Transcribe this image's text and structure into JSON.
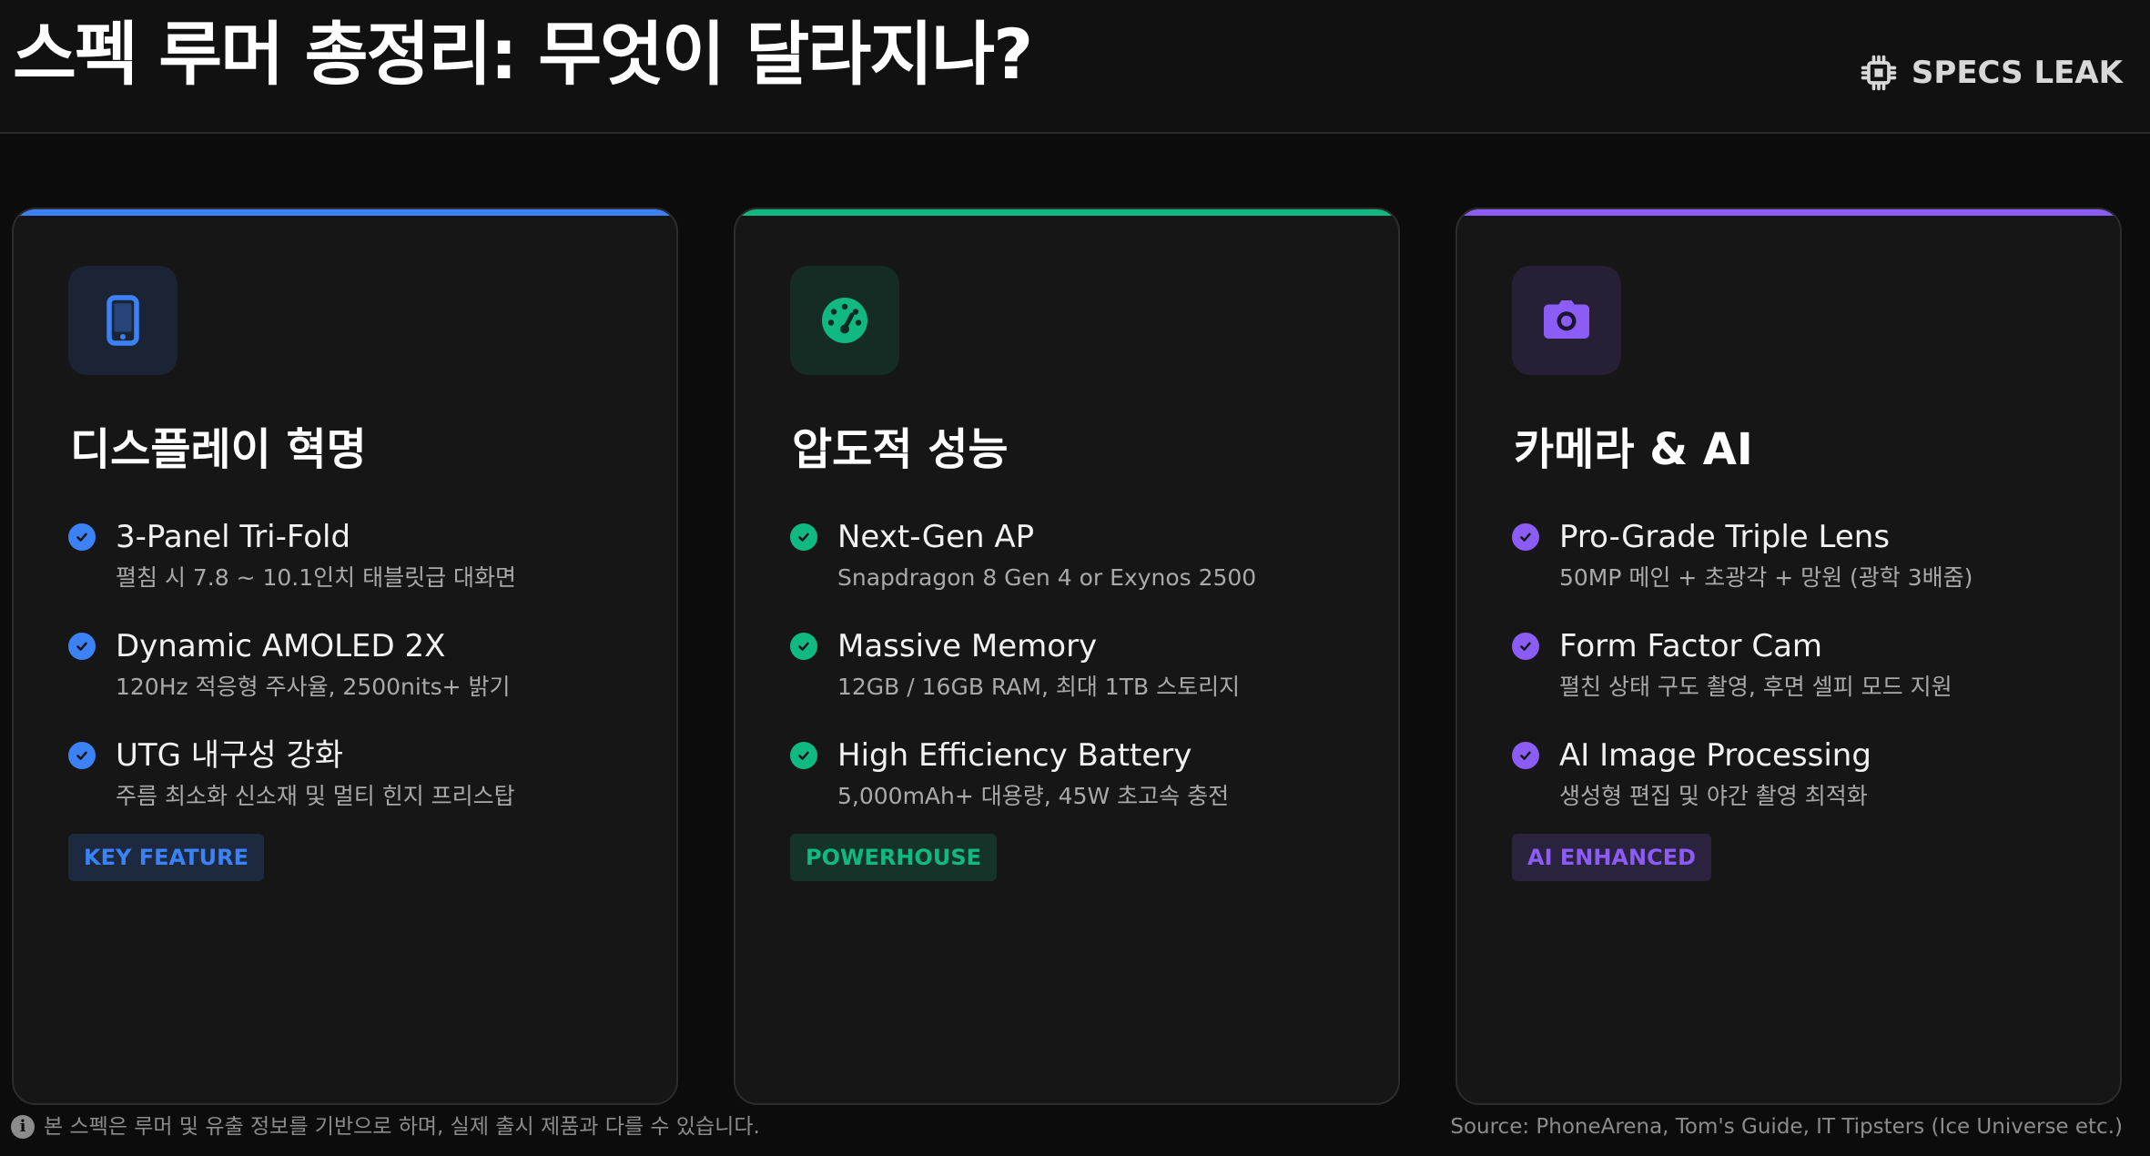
{
  "header": {
    "title": "스펙 루머 총정리: 무엇이 달라지나?",
    "brand": {
      "icon": "cpu-chip-icon",
      "label": "SPECS LEAK"
    }
  },
  "cards": [
    {
      "accent": "#3b82f6",
      "icon": "smartphone-icon",
      "title": "디스플레이 혁명",
      "features": [
        {
          "title": "3-Panel Tri-Fold",
          "desc": "펼침 시 7.8 ~ 10.1인치 태블릿급 대화면"
        },
        {
          "title": "Dynamic AMOLED 2X",
          "desc": "120Hz 적응형 주사율, 2500nits+ 밝기"
        },
        {
          "title": "UTG 내구성 강화",
          "desc": "주름 최소화 신소재 및 멀티 힌지 프리스탑"
        }
      ],
      "badge": "KEY FEATURE"
    },
    {
      "accent": "#10b981",
      "icon": "speedometer-icon",
      "title": "압도적 성능",
      "features": [
        {
          "title": "Next-Gen AP",
          "desc": "Snapdragon 8 Gen 4 or Exynos 2500"
        },
        {
          "title": "Massive Memory",
          "desc": "12GB / 16GB RAM, 최대 1TB 스토리지"
        },
        {
          "title": "High Efficiency Battery",
          "desc": "5,000mAh+ 대용량, 45W 초고속 충전"
        }
      ],
      "badge": "POWERHOUSE"
    },
    {
      "accent": "#8b5cf6",
      "icon": "camera-icon",
      "title": "카메라 & AI",
      "features": [
        {
          "title": "Pro-Grade Triple Lens",
          "desc": "50MP 메인 + 초광각 + 망원 (광학 3배줌)"
        },
        {
          "title": "Form Factor Cam",
          "desc": "펼친 상태 구도 촬영, 후면 셀피 모드 지원"
        },
        {
          "title": "AI Image Processing",
          "desc": "생성형 편집 및 야간 촬영 최적화"
        }
      ],
      "badge": "AI ENHANCED"
    }
  ],
  "footer": {
    "icon": "info-icon",
    "disclaimer": "본 스펙은 루머 및 유출 정보를 기반으로 하며, 실제 출시 제품과 다를 수 있습니다.",
    "source": "Source: PhoneArena, Tom's Guide, IT Tipsters (Ice Universe etc.)"
  }
}
